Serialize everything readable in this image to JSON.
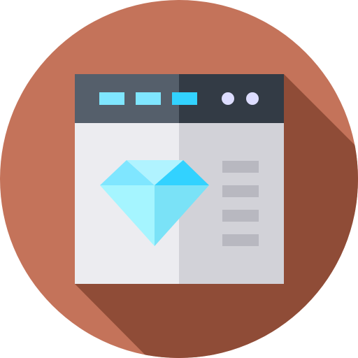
{
  "icon": {
    "name": "browser-window-diamond-icon",
    "colors": {
      "circle": "#c4735a",
      "long_shadow": "#8f4c37",
      "titlebar_left": "#555f6b",
      "titlebar_right": "#333b45",
      "titlebar_tab": "#7fe6ff",
      "titlebar_tab_active": "#32d2ff",
      "window_dot": "#ddddff",
      "pane_left": "#ececf0",
      "pane_right": "#d2d2d8",
      "text_line": "#b8b8c0",
      "diamond_top_left": "#7fe6ff",
      "diamond_top_center": "#b0f3ff",
      "diamond_top_right": "#32d2ff",
      "diamond_bottom_left": "#a5f5ff",
      "diamond_bottom_right": "#7ae2f7"
    }
  }
}
